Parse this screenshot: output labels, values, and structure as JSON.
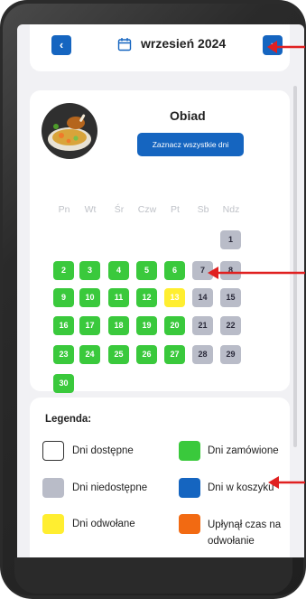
{
  "header": {
    "month": "wrzesień 2024",
    "prev_icon": "chevron-left-icon",
    "next_icon": "chevron-right-icon"
  },
  "meal": {
    "title": "Obiad",
    "select_all_label": "Zaznacz wszystkie dni"
  },
  "weekdays": [
    "Pn",
    "Wt",
    "Śr",
    "Czw",
    "Pt",
    "Sb",
    "Ndz"
  ],
  "days": [
    {
      "label": "1",
      "status": "unavailable"
    },
    {
      "label": "2",
      "status": "ordered"
    },
    {
      "label": "3",
      "status": "ordered"
    },
    {
      "label": "4",
      "status": "ordered"
    },
    {
      "label": "5",
      "status": "ordered"
    },
    {
      "label": "6",
      "status": "ordered"
    },
    {
      "label": "7",
      "status": "unavailable"
    },
    {
      "label": "8",
      "status": "unavailable"
    },
    {
      "label": "9",
      "status": "ordered"
    },
    {
      "label": "10",
      "status": "ordered"
    },
    {
      "label": "11",
      "status": "ordered"
    },
    {
      "label": "12",
      "status": "ordered"
    },
    {
      "label": "13",
      "status": "cancelled"
    },
    {
      "label": "14",
      "status": "unavailable"
    },
    {
      "label": "15",
      "status": "unavailable"
    },
    {
      "label": "16",
      "status": "ordered"
    },
    {
      "label": "17",
      "status": "ordered"
    },
    {
      "label": "18",
      "status": "ordered"
    },
    {
      "label": "19",
      "status": "ordered"
    },
    {
      "label": "20",
      "status": "ordered"
    },
    {
      "label": "21",
      "status": "unavailable"
    },
    {
      "label": "22",
      "status": "unavailable"
    },
    {
      "label": "23",
      "status": "ordered"
    },
    {
      "label": "24",
      "status": "ordered"
    },
    {
      "label": "25",
      "status": "ordered"
    },
    {
      "label": "26",
      "status": "ordered"
    },
    {
      "label": "27",
      "status": "ordered"
    },
    {
      "label": "28",
      "status": "unavailable"
    },
    {
      "label": "29",
      "status": "unavailable"
    },
    {
      "label": "30",
      "status": "ordered"
    }
  ],
  "legend": {
    "title": "Legenda:",
    "items": [
      {
        "label": "Dni dostępne",
        "status": "available"
      },
      {
        "label": "Dni zamówione",
        "status": "ordered"
      },
      {
        "label": "Dni niedostępne",
        "status": "unavailable"
      },
      {
        "label": "Dni w koszyku",
        "status": "cart"
      },
      {
        "label": "Dni odwołane",
        "status": "cancelled"
      },
      {
        "label": "Upłynął czas na odwołanie",
        "status": "expired"
      }
    ]
  },
  "colors": {
    "ordered": "#3ac93c",
    "unavailable": "#b9bcc8",
    "cart": "#1565c0",
    "cancelled": "#ffee30",
    "expired": "#f26a12",
    "annotation": "#e02020"
  }
}
